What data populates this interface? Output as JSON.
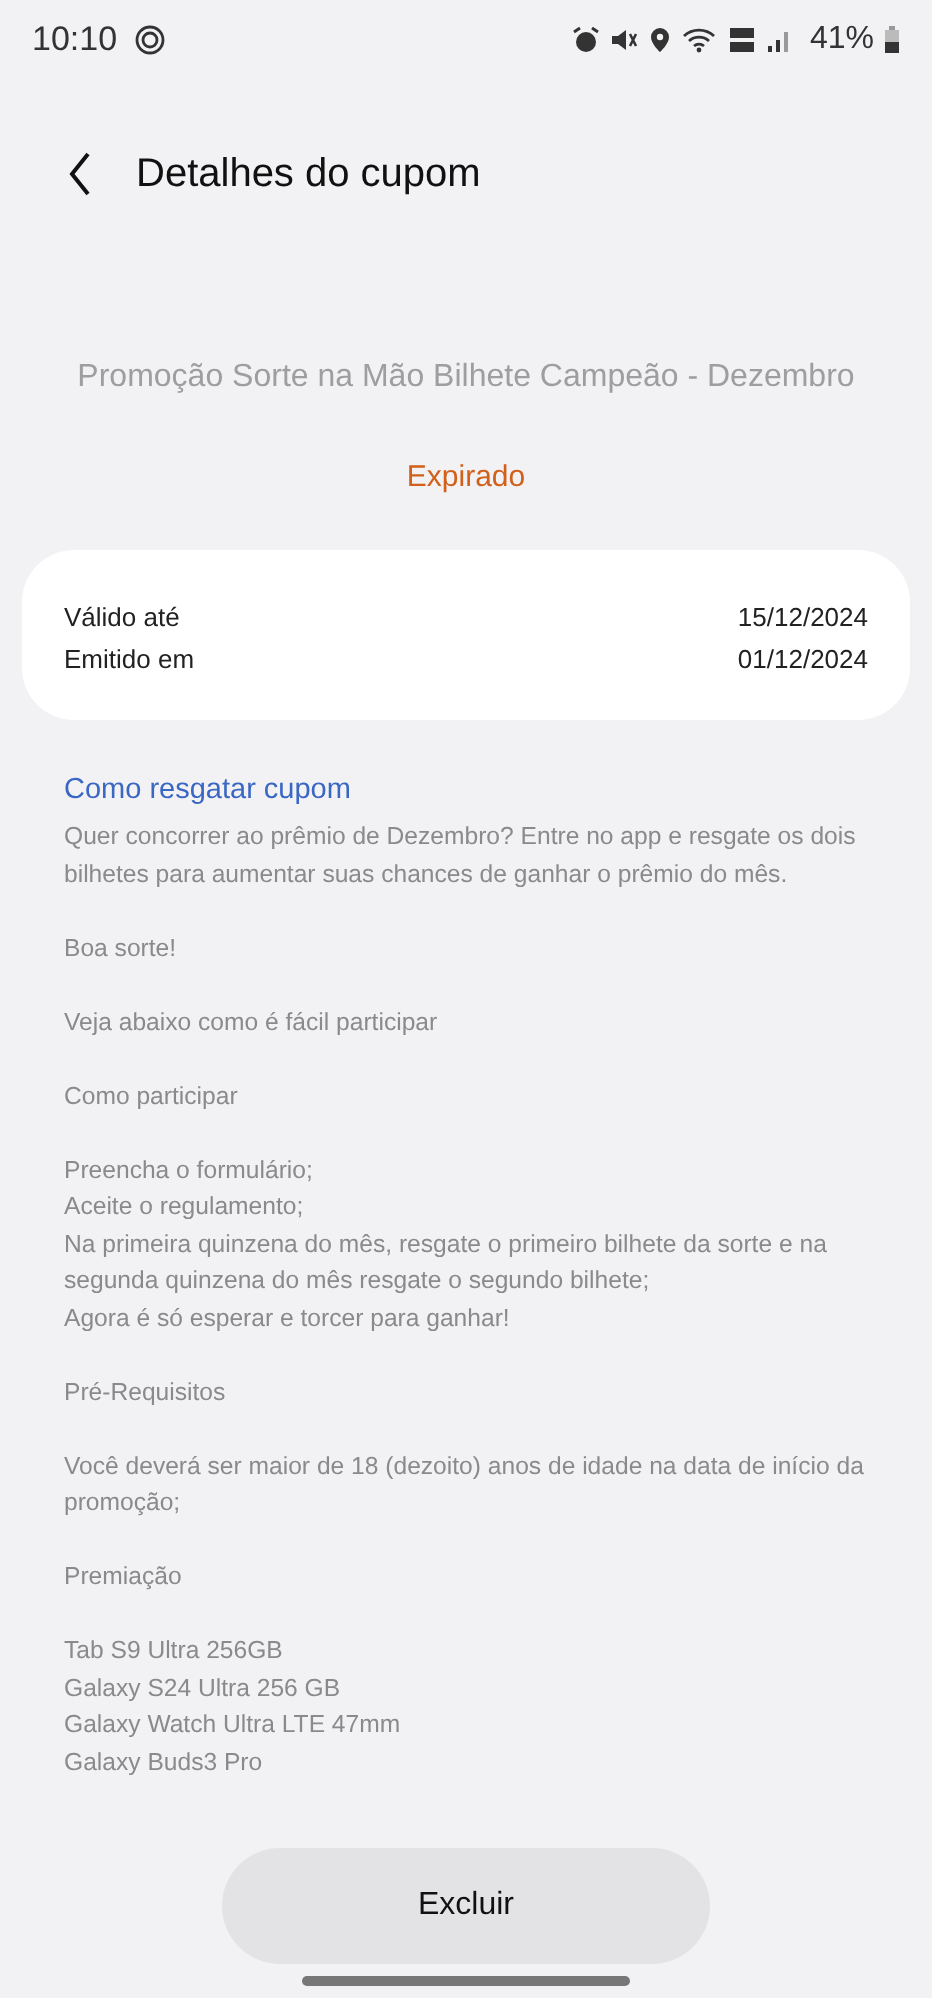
{
  "status_bar": {
    "time": "10:10",
    "battery": "41%"
  },
  "header": {
    "title": "Detalhes do cupom"
  },
  "coupon": {
    "name": "Promoção Sorte na Mão Bilhete Campeão - Dezembro",
    "status": "Expirado"
  },
  "dates": [
    {
      "label": "Válido até",
      "value": "15/12/2024"
    },
    {
      "label": "Emitido em",
      "value": "01/12/2024"
    }
  ],
  "how_to": {
    "heading": "Como resgatar cupom",
    "paragraphs": [
      [
        "Quer concorrer ao prêmio de Dezembro? Entre no app e resgate os dois bilhetes para aumentar suas chances de ganhar o prêmio do mês."
      ],
      [
        "Boa sorte!"
      ],
      [
        "Veja abaixo como é fácil participar"
      ],
      [
        "Como participar"
      ],
      [
        "Preencha o formulário;",
        "Aceite o regulamento;",
        "Na primeira quinzena do mês, resgate o primeiro bilhete da sorte e na segunda quinzena do mês resgate o segundo bilhete;",
        "Agora é só esperar e torcer para ganhar!"
      ],
      [
        "Pré-Requisitos"
      ],
      [
        "Você deverá ser maior de 18 (dezoito) anos de idade na data de início da promoção;"
      ],
      [
        "Premiação"
      ],
      [
        "Tab S9 Ultra 256GB",
        "Galaxy S24 Ultra 256 GB",
        "Galaxy Watch Ultra LTE 47mm",
        "Galaxy Buds3 Pro"
      ]
    ]
  },
  "button": {
    "label": "Excluir"
  }
}
